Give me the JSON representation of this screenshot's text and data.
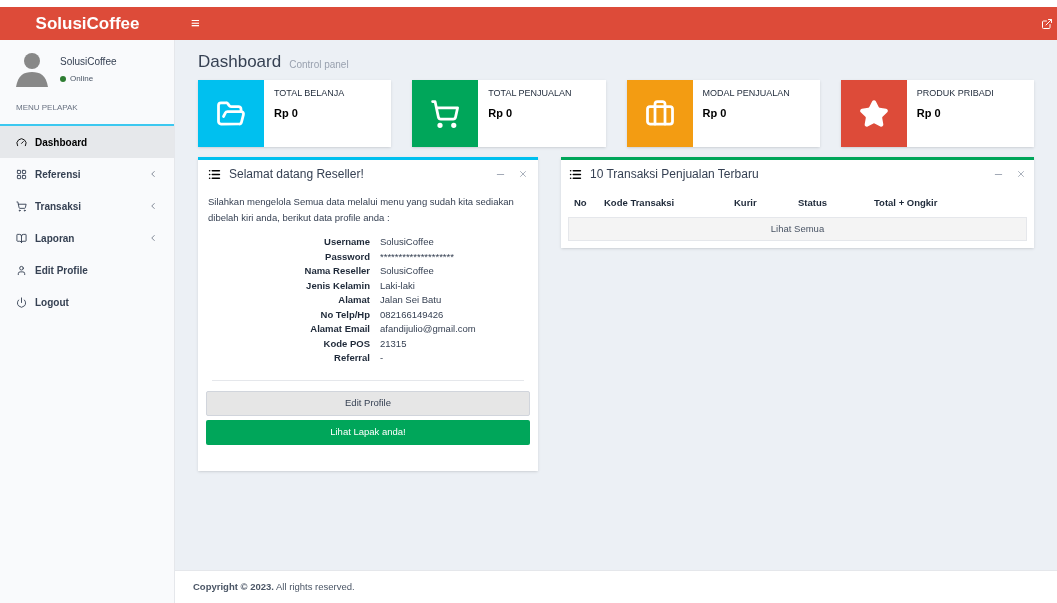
{
  "header": {
    "logo": "SolusiCoffee",
    "menu_glyph": "≡"
  },
  "user": {
    "name": "SolusiCoffee",
    "status": "Online"
  },
  "sidebar": {
    "heading": "MENU PELAPAK",
    "items": [
      {
        "label": "Dashboard",
        "kind": "gauge",
        "selected": true,
        "has_submenu": false
      },
      {
        "label": "Referensi",
        "kind": "grid",
        "selected": false,
        "has_submenu": true
      },
      {
        "label": "Transaksi",
        "kind": "cart",
        "selected": false,
        "has_submenu": true
      },
      {
        "label": "Laporan",
        "kind": "book",
        "selected": false,
        "has_submenu": true
      },
      {
        "label": "Edit Profile",
        "kind": "user",
        "selected": false,
        "has_submenu": false
      },
      {
        "label": "Logout",
        "kind": "power",
        "selected": false,
        "has_submenu": false
      }
    ]
  },
  "page": {
    "title": "Dashboard",
    "subtitle": "Control panel"
  },
  "info_boxes": [
    {
      "label": "TOTAL BELANJA",
      "value": "Rp 0",
      "kind": "folder",
      "color": "#00c0ef"
    },
    {
      "label": "TOTAL PENJUALAN",
      "value": "Rp 0",
      "kind": "cart",
      "color": "#00a65a"
    },
    {
      "label": "MODAL PENJUALAN",
      "value": "Rp 0",
      "kind": "briefcase",
      "color": "#f39c12"
    },
    {
      "label": "PRODUK PRIBADI",
      "value": "Rp 0",
      "kind": "star",
      "color": "#dd4b39"
    }
  ],
  "welcome_box": {
    "title": "Selamat datang Reseller!",
    "intro": "Silahkan mengelola Semua data melalui menu yang sudah kita sediakan dibelah kiri anda, berikut data profile anda :",
    "profile": [
      {
        "label": "Username",
        "value": "SolusiCoffee"
      },
      {
        "label": "Password",
        "value": "********************"
      },
      {
        "label": "Nama Reseller",
        "value": "SolusiCoffee"
      },
      {
        "label": "Jenis Kelamin",
        "value": "Laki-laki"
      },
      {
        "label": "Alamat",
        "value": "Jalan Sei Batu"
      },
      {
        "label": "No Telp/Hp",
        "value": "082166149426"
      },
      {
        "label": "Alamat Email",
        "value": "afandijulio@gmail.com"
      },
      {
        "label": "Kode POS",
        "value": "21315"
      },
      {
        "label": "Referral",
        "value": "-"
      }
    ],
    "buttons": [
      "Edit Profile",
      "Lihat Lapak anda!"
    ]
  },
  "transactions_box": {
    "title": "10 Transaksi Penjualan Terbaru",
    "columns": [
      "No",
      "Kode Transaksi",
      "Kurir",
      "Status",
      "Total + Ongkir"
    ],
    "view_all": "Lihat Semua"
  },
  "footer": "**Copyright © 2023.** All rights reserved."
}
